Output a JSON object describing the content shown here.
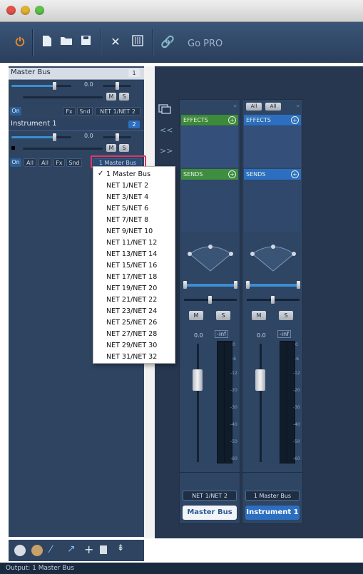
{
  "toolbar": {
    "gopro_label": "Go PRO",
    "icons": [
      "power-icon",
      "new-document-icon",
      "open-folder-icon",
      "save-icon",
      "tools-icon",
      "mixer-settings-icon",
      "link-icon"
    ]
  },
  "tracks": [
    {
      "name": "Master Bus",
      "number": "1",
      "volume": "0.0",
      "mute_label": "M",
      "solo_label": "S",
      "on_label": "On",
      "fx_label": "Fx",
      "snd_label": "Snd",
      "output": "NET 1/NET 2"
    },
    {
      "name": "Instrument 1",
      "number": "2",
      "volume": "0.0",
      "mute_label": "M",
      "solo_label": "S",
      "on_label": "On",
      "all1_label": "All",
      "all2_label": "All",
      "fx_label": "Fx",
      "snd_label": "Snd",
      "output": "1 Master Bus"
    }
  ],
  "output_menu": {
    "items": [
      "1 Master Bus",
      "NET 1/NET 2",
      "NET 3/NET 4",
      "NET 5/NET 6",
      "NET 7/NET 8",
      "NET 9/NET 10",
      "NET 11/NET 12",
      "NET 13/NET 14",
      "NET 15/NET 16",
      "NET 17/NET 18",
      "NET 19/NET 20",
      "NET 21/NET 22",
      "NET 23/NET 24",
      "NET 25/NET 26",
      "NET 27/NET 28",
      "NET 29/NET 30",
      "NET 31/NET 32"
    ],
    "checked": "1 Master Bus"
  },
  "mixer": {
    "collapse_label": "<<",
    "expand_label": ">>",
    "strips": [
      {
        "effects_label": "EFFECTS",
        "sends_label": "SENDS",
        "mute_label": "M",
        "solo_label": "S",
        "volume": "0.0",
        "peak": "-inf",
        "output": "NET 1/NET 2",
        "name": "Master Bus",
        "all_labels": []
      },
      {
        "effects_label": "EFFECTS",
        "sends_label": "SENDS",
        "mute_label": "M",
        "solo_label": "S",
        "volume": "0.0",
        "peak": "-inf",
        "output": "1 Master Bus",
        "name": "Instrument 1",
        "all_labels": [
          "All",
          "All"
        ]
      }
    ],
    "meter_scale": [
      "0",
      "-6",
      "-12",
      "-20",
      "-30",
      "-40",
      "-50",
      "-60"
    ]
  },
  "bottom_toolbar": {
    "plus_label": "+"
  },
  "status": {
    "output_text": "Output: 1 Master Bus"
  },
  "colors": {
    "accent": "#2d5d95",
    "effects_green": "#3d8a3a",
    "sends_green": "#3f8d40",
    "highlight": "#e0366b",
    "name_selected_bg": "#2c6fc0"
  }
}
